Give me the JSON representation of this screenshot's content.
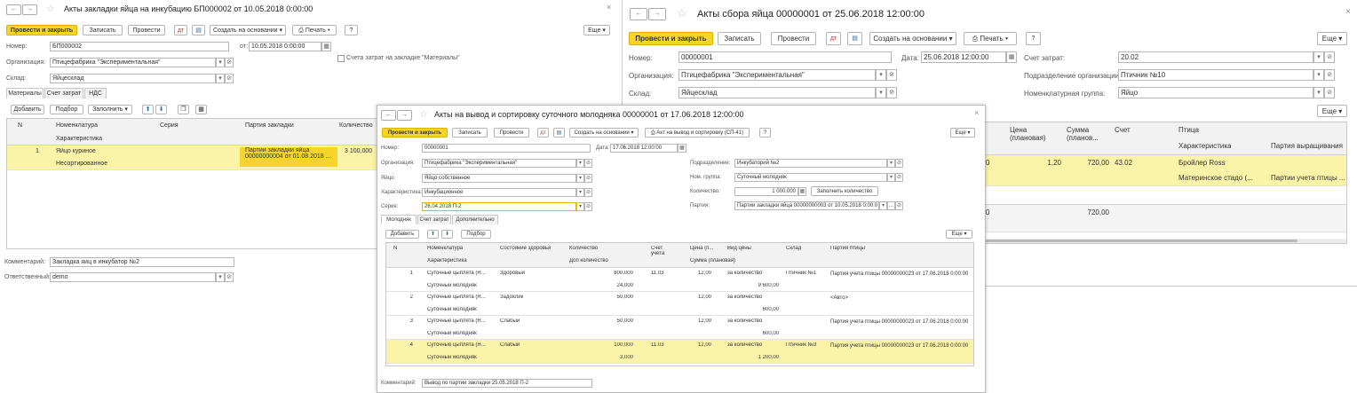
{
  "common": {
    "back": "←",
    "forward": "→",
    "star": "☆",
    "close": "×",
    "more": "Еще",
    "caret": "▾",
    "dots": "…",
    "open": "⊘",
    "cal": "▦"
  },
  "w1": {
    "title": "Акты закладки яйца на инкубацию БП000002 от 10.05.2018 0:00:00",
    "post_close": "Провести и закрыть",
    "save": "Записать",
    "post": "Провести",
    "create_based": "Создать на основании",
    "print": "Печать",
    "help": "?",
    "number_label": "Номер:",
    "number": "БП000002",
    "date_label": "от:",
    "date": "10.05.2018  0:00:00",
    "checkbox": "Счета затрат на закладке \"Материалы\"",
    "org_label": "Организация:",
    "org": "Птицефабрика \"Экспериментальная\"",
    "wh_label": "Склад:",
    "wh": "Яйцесклад",
    "tabs": [
      "Материалы",
      "Счет затрат",
      "НДС"
    ],
    "add": "Добавить",
    "select": "Подбор",
    "fill": "Заполнить",
    "cols": {
      "n": "N",
      "nom": "Номенклатура",
      "char": "Характеристика",
      "series": "Серия",
      "batch": "Партия закладки",
      "qty": "Количество"
    },
    "row": {
      "n": "1",
      "nom": "Яйцо куриное",
      "char": "Несортированное",
      "batch1": "Партии закладки яйца",
      "batch2": "00000000004 от 01.08.2018 ...",
      "qty": "3 100,000"
    },
    "comment_label": "Комментарий:",
    "comment": "Закладка яиц в инкубатор №2",
    "resp_label": "Ответственный:",
    "resp": "demo"
  },
  "w2": {
    "title": "Акты сбора яйца 00000001 от 25.06.2018 12:00:00",
    "post_close": "Провести и закрыть",
    "save": "Записать",
    "post": "Провести",
    "create_based": "Создать на основании",
    "print": "Печать",
    "help": "?",
    "number_label": "Номер:",
    "number": "00000001",
    "date_label": "Дата:",
    "date": "25.06.2018 12:00:00",
    "cost_label": "Счет затрат:",
    "cost": "20.02",
    "org_label": "Организация:",
    "org": "Птицефабрика \"Экспериментальная\"",
    "div_label": "Подразделение организации:",
    "div": "Птичник №10",
    "wh_label": "Склад:",
    "wh": "Яйцесклад",
    "nomgr_label": "Номенклатурная группа:",
    "nomgr": "Яйцо",
    "cols": {
      "o": "о",
      "price": "Цена (плановая)",
      "sum": "Сумма (планов...",
      "acc": "Счет",
      "bird": "Птица",
      "char": "Характеристика",
      "batch": "Партия выращивания"
    },
    "row1": {
      "q": "000",
      "price": "1,20",
      "sum": "720,00",
      "acc": "43.02",
      "bird": "Бройлер Ross",
      "char": "Материнское стадо (...",
      "batch": "Партии учета птицы ..."
    },
    "total": {
      "q": "000",
      "sum": "720,00"
    }
  },
  "w3": {
    "title": "Акты на вывод и сортировку суточного молодняка 00000001 от 17.06.2018 12:00:00",
    "post_close": "Провести и закрыть",
    "save": "Записать",
    "post": "Провести",
    "create_based": "Создать на основании",
    "act_print": "Акт на вывод и сортировку (СП-41)",
    "help": "?",
    "number_label": "Номер:",
    "number": "00000001",
    "date_label": "Дата:",
    "date": "17.06.2018 12:00:00",
    "div_label": "Подразделение:",
    "div": "Инкубаторий №2",
    "org_label": "Организация:",
    "org": "Птицефабрика \"Экспериментальная\"",
    "nomgr_label": "Ном. группа:",
    "nomgr": "Суточный молодняк",
    "egg_label": "Яйцо:",
    "egg": "Яйцо собственное",
    "qty_label": "Количество:",
    "qty": "1 000,000",
    "fill_qty": "Заполнить количество",
    "char_label": "Характеристика:",
    "char": "Инкубационное",
    "batch_label": "Партия:",
    "batch": "Партии закладки яйца 00000000003 от 10.05.2018 0:00:0",
    "series_label": "Серия:",
    "series": "26.04.2018 П-2",
    "tabs": [
      "Молодняк",
      "Счет затрат",
      "Дополнительно"
    ],
    "add": "Добавить",
    "select": "Подбор",
    "cols": {
      "n": "N",
      "nom": "Номенклатура",
      "char": "Характеристика",
      "health": "Состояние здоровья",
      "qty": "Количество",
      "qty2": "Доп количество",
      "acc": "Счет учета",
      "price": "Цена (п...",
      "ptype": "Вид цены",
      "sum": "Сумма (плановая)",
      "wh": "Склад",
      "batch": "Партия птицы"
    },
    "rows": [
      {
        "n": "1",
        "nom": "Суточные цыплята (R...",
        "char": "Суточный молодняк",
        "health": "Здоровый",
        "qty": "800,000",
        "qty2": "24,000",
        "acc": "11.03",
        "price": "12,00",
        "ptype": "за количество",
        "sum": "9 600,00",
        "wh": "Птичник №1",
        "batch": "Партия учета птицы 00000000023 от 17.06.2018 0:00:00"
      },
      {
        "n": "2",
        "nom": "Суточные цыплята (R...",
        "char": "Суточный молодняк",
        "health": "Задохлик",
        "qty": "50,000",
        "qty2": "",
        "acc": "",
        "price": "12,00",
        "ptype": "за количество",
        "sum": "600,00",
        "wh": "",
        "batch": "<Авто>"
      },
      {
        "n": "3",
        "nom": "Суточные цыплята (R...",
        "char": "Суточный молодняк",
        "health": "Слабый",
        "qty": "50,000",
        "qty2": "",
        "acc": "",
        "price": "12,00",
        "ptype": "за количество",
        "sum": "600,00",
        "wh": "",
        "batch": "Партия учета птицы 00000000023 от 17.06.2018 0:00:00"
      },
      {
        "n": "4",
        "nom": "Суточные цыплята (R...",
        "char": "Суточный молодняк",
        "health": "Слабый",
        "qty": "100,000",
        "qty2": "3,000",
        "acc": "11.03",
        "price": "12,00",
        "ptype": "за количество",
        "sum": "1 200,00",
        "wh": "Птичник №3",
        "batch": "Партия учета птицы 00000000023 от 17.06.2018 0:00:00"
      }
    ],
    "comment_label": "Комментарий:",
    "comment": "Вывод по партии закладки 25.05.2018 П-2"
  }
}
